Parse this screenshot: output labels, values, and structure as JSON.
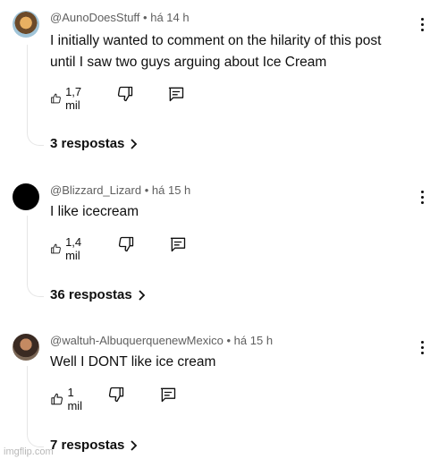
{
  "comments": [
    {
      "handle": "@AunoDoesStuff",
      "time": "há 14 h",
      "text_line1": "I initially wanted to comment on the hilarity of this post",
      "text_line2": "until I saw two guys arguing about Ice Cream",
      "likes": "1,7 mil",
      "replies": "3 respostas"
    },
    {
      "handle": "@Blizzard_Lizard",
      "time": "há 15 h",
      "text_line1": "I like icecream",
      "likes": "1,4 mil",
      "replies": "36 respostas"
    },
    {
      "handle": "@waltuh-AlbuquerquenewMexico",
      "time": "há 15 h",
      "text_line1": "Well I DONT like ice cream",
      "likes": "1 mil",
      "replies": "7 respostas"
    }
  ],
  "separator": "•",
  "icons": {
    "like": "thumbs-up-icon",
    "dislike": "thumbs-down-icon",
    "reply": "comment-icon",
    "more": "more-vertical-icon",
    "expand": "chevron-right-icon"
  },
  "watermark": "imgflip.com"
}
